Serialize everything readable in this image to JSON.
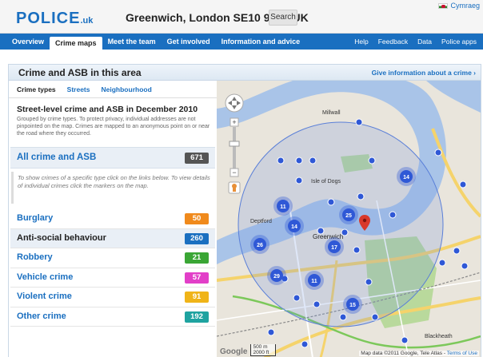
{
  "header": {
    "logo_main": "POLICE",
    "logo_suffix": ".uk",
    "location": "Greenwich, London SE10 9JW, UK",
    "search_label": "Search",
    "language_link": "Cymraeg"
  },
  "nav": {
    "left": [
      "Overview",
      "Crime maps",
      "Meet the team",
      "Get involved",
      "Information and advice"
    ],
    "active": "Crime maps",
    "right": [
      "Help",
      "Feedback",
      "Data",
      "Police apps"
    ]
  },
  "panel": {
    "title": "Crime and ASB in this area",
    "give_info": "Give information about a crime ›"
  },
  "sidebar": {
    "tabs": [
      "Crime types",
      "Streets",
      "Neighbourhood"
    ],
    "intro_title": "Street-level crime and ASB in December 2010",
    "intro_body": "Grouped by crime types. To protect privacy, individual addresses are not pinpointed on the map. Crimes are mapped to an anonymous point on or near the road where they occurred.",
    "all_label": "All crime and ASB",
    "all_count": "671",
    "note": "To show crimes of a specific type click on the links below. To view details of individual crimes click the markers on the map.",
    "categories": [
      {
        "label": "Burglary",
        "count": "50",
        "color": "#f08a1c"
      },
      {
        "label": "Anti-social behaviour",
        "count": "260",
        "color": "#1a6fc0"
      },
      {
        "label": "Robbery",
        "count": "21",
        "color": "#3aa635"
      },
      {
        "label": "Vehicle crime",
        "count": "57",
        "color": "#e23fc8"
      },
      {
        "label": "Violent crime",
        "count": "91",
        "color": "#f0b418"
      },
      {
        "label": "Other crime",
        "count": "192",
        "color": "#1fa3a0"
      }
    ]
  },
  "map": {
    "place_labels": [
      "Millwall",
      "Isle of Dogs",
      "Greenwich",
      "Deptford",
      "Blackheath"
    ],
    "clusters": [
      "11",
      "14",
      "25",
      "26",
      "17",
      "14",
      "29",
      "11",
      "15"
    ],
    "scale_top": "500 m",
    "scale_bottom": "2000 ft",
    "google": "Google",
    "attribution": "Map data ©2011 Google, Tele Atlas - ",
    "terms": "Terms of Use",
    "colors": {
      "water": "#a9c4e8",
      "land": "#e9e5dc",
      "park": "#b9d99c",
      "cluster": "#2f58d6"
    }
  }
}
